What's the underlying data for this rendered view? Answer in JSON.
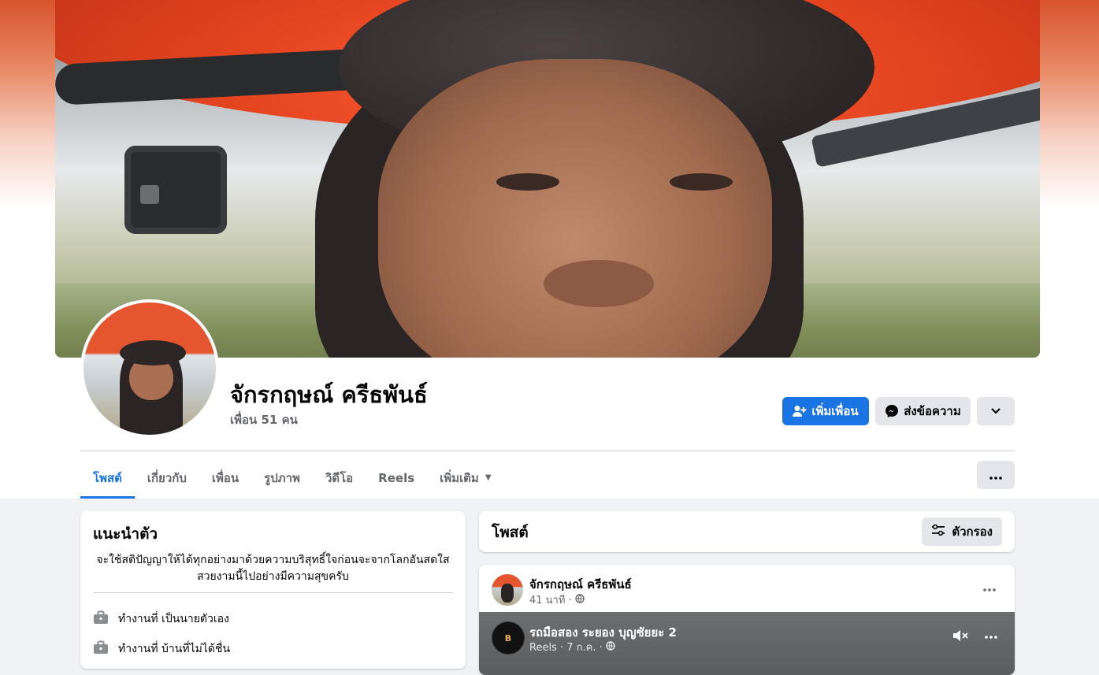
{
  "profile": {
    "name": "จักรกฤษณ์ ครีธพันธ์",
    "friends_count": "เพื่อน 51 คน"
  },
  "actions": {
    "add_friend": "เพิ่มเพื่อน",
    "message": "ส่งข้อความ"
  },
  "tabs": [
    {
      "label": "โพสต์",
      "active": true
    },
    {
      "label": "เกี่ยวกับ"
    },
    {
      "label": "เพื่อน"
    },
    {
      "label": "รูปภาพ"
    },
    {
      "label": "วิดีโอ"
    },
    {
      "label": "Reels"
    },
    {
      "label": "เพิ่มเติม"
    }
  ],
  "intro": {
    "title": "แนะนำตัว",
    "bio": "จะใช้สติปัญญาให้ได้ทุกอย่างมาด้วยความบริสุทธิ์ใจก่อนจะจากโลกอันสดใส สวยงามนี้ไปอย่างมีความสุขครับ",
    "items": [
      {
        "text": "ทำงานที่ เป็นนายตัวเอง",
        "icon": "briefcase-icon"
      },
      {
        "text": "ทำงานที่ บ้านที่ไม่ได้ชื่น",
        "icon": "briefcase-icon"
      }
    ]
  },
  "posts": {
    "title": "โพสต์",
    "filter_label": "ตัวกรอง"
  },
  "post": {
    "author": "จักรกฤษณ์ ครีธพันธ์",
    "time": "41 นาที ·",
    "reel": {
      "title": "รถมือสอง ระยอง บุญชัยยะ 2",
      "meta": "Reels · 7 ก.ค. ·",
      "avatar_text": "B"
    }
  },
  "colors": {
    "accent": "#1b74e4",
    "secondary_bg": "#e4e6eb",
    "page_bg": "#f0f2f5"
  }
}
